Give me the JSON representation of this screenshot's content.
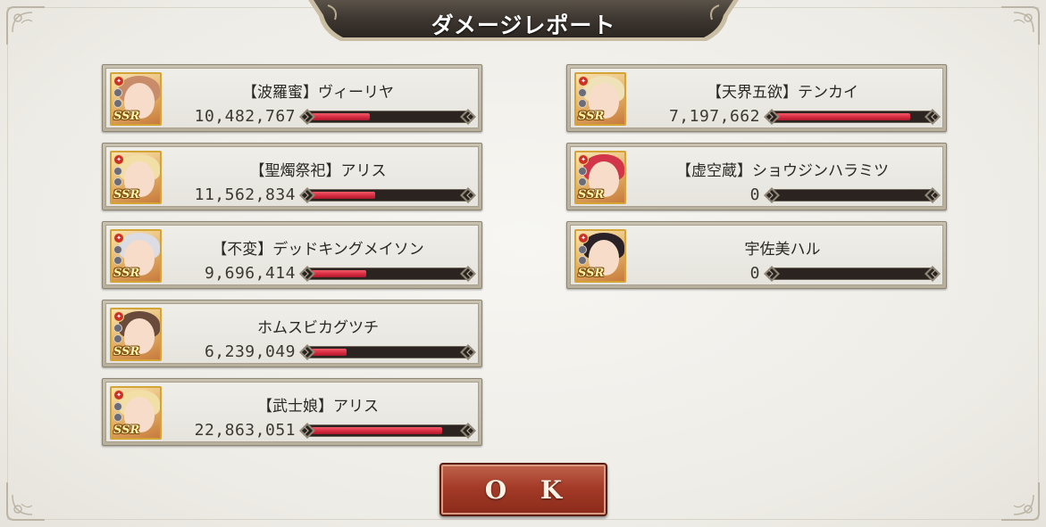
{
  "dialog": {
    "title": "ダメージレポート",
    "ok_label": "O K"
  },
  "gauge_colors": {
    "fill": "#d82a40",
    "track": "#2a2320"
  },
  "characters": [
    {
      "name": "【波羅蜜】ヴィーリヤ",
      "damage": "10,482,767",
      "damage_ratio": 0.38,
      "rarity": "SSR",
      "hair_color": "#c98c6a"
    },
    {
      "name": "【聖燭祭祀】アリス",
      "damage": "11,562,834",
      "damage_ratio": 0.42,
      "rarity": "SSR",
      "hair_color": "#f2dfa6"
    },
    {
      "name": "【不変】デッドキングメイソン",
      "damage": "9,696,414",
      "damage_ratio": 0.36,
      "rarity": "SSR",
      "hair_color": "#dcdce4"
    },
    {
      "name": "ホムスビカグツチ",
      "damage": "6,239,049",
      "damage_ratio": 0.23,
      "rarity": "SSR",
      "hair_color": "#6a4a3a"
    },
    {
      "name": "【武士娘】アリス",
      "damage": "22,863,051",
      "damage_ratio": 0.86,
      "rarity": "SSR",
      "hair_color": "#f2dfa6"
    },
    {
      "name": "【天界五欲】テンカイ",
      "damage": "7,197,662",
      "damage_ratio": 0.88,
      "rarity": "SSR",
      "hair_color": "#f0e2b8"
    },
    {
      "name": "【虚空蔵】ショウジンハラミツ",
      "damage": "0",
      "damage_ratio": 0,
      "rarity": "SSR",
      "hair_color": "#d2344a"
    },
    {
      "name": "宇佐美ハル",
      "damage": "0",
      "damage_ratio": 0,
      "rarity": "SSR",
      "hair_color": "#2a2226"
    }
  ]
}
